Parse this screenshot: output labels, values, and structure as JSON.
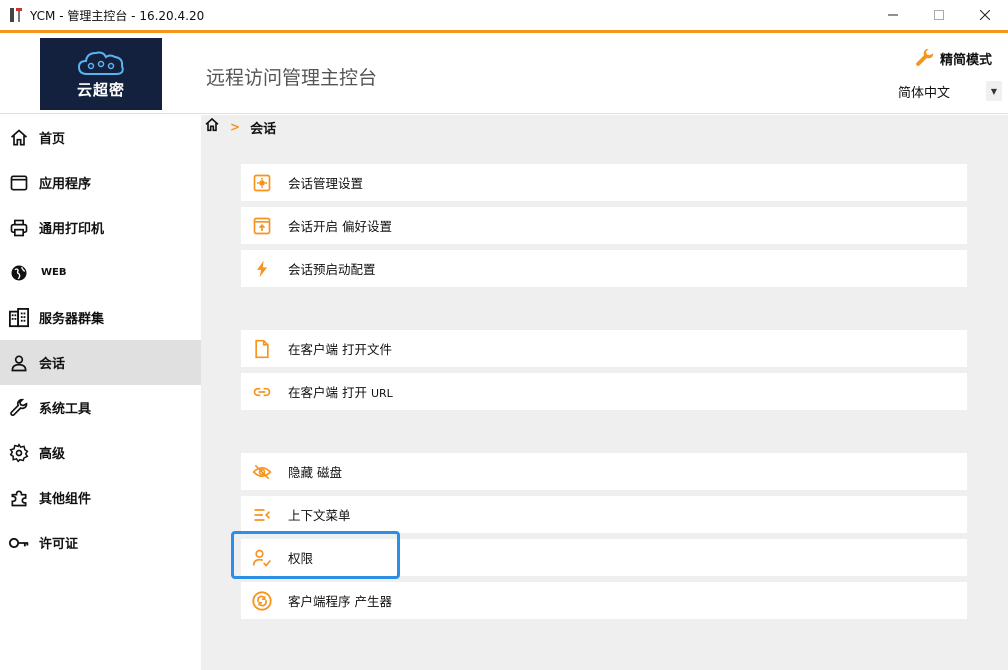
{
  "window": {
    "title": "YCM - 管理主控台 - 16.20.4.20",
    "icons": {
      "app": "app-logo-icon",
      "minimize": "minimize-icon",
      "maximize": "maximize-icon",
      "close": "close-icon"
    }
  },
  "header": {
    "logo_text": "云超密",
    "console_title": "远程访问管理主控台",
    "simple_mode_label": "精简模式",
    "language": "简体中文"
  },
  "sidebar": {
    "items": [
      {
        "label": "首页",
        "icon": "home-icon"
      },
      {
        "label": "应用程序",
        "icon": "window-icon"
      },
      {
        "label": "通用打印机",
        "icon": "printer-icon"
      },
      {
        "label": "WEB",
        "icon": "globe-icon"
      },
      {
        "label": "服务器群集",
        "icon": "building-icon"
      },
      {
        "label": "会话",
        "icon": "user-icon",
        "active": true
      },
      {
        "label": "系统工具",
        "icon": "wrench-icon"
      },
      {
        "label": "高级",
        "icon": "gear-icon"
      },
      {
        "label": "其他组件",
        "icon": "puzzle-icon"
      },
      {
        "label": "许可证",
        "icon": "key-icon"
      }
    ]
  },
  "breadcrumb": {
    "current": "会话",
    "separator": ">"
  },
  "main": {
    "rows": [
      {
        "label": "会话管理设置",
        "icon": "settings-box-icon"
      },
      {
        "label": "会话开启 偏好设置",
        "icon": "upload-box-icon"
      },
      {
        "label": "会话预启动配置",
        "icon": "lightning-icon"
      },
      {
        "label": "在客户端 打开文件",
        "icon": "file-icon"
      },
      {
        "label_cn": "在客户端 打开 ",
        "label_latin": "URL",
        "icon": "link-icon"
      },
      {
        "label": "隐藏 磁盘",
        "icon": "eye-off-icon"
      },
      {
        "label": "上下文菜单",
        "icon": "menu-collapse-icon"
      },
      {
        "label": "权限",
        "icon": "user-check-icon"
      },
      {
        "label": "客户端程序 产生器",
        "icon": "refresh-circle-icon"
      }
    ]
  },
  "colors": {
    "accent": "#f7941d",
    "highlight": "#2b8fe5",
    "logo_bg": "#13213f",
    "main_bg": "#efefef",
    "active_bg": "#e0e0e0"
  }
}
